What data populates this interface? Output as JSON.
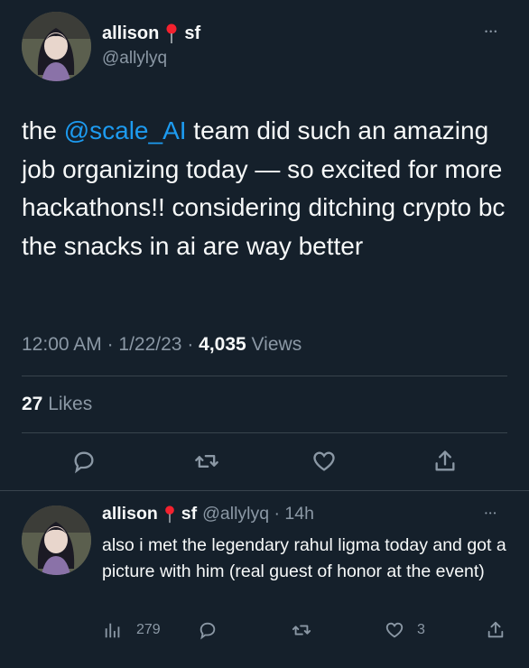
{
  "tweet": {
    "author_name": "allison",
    "author_location": "sf",
    "handle": "@allylyq",
    "text_before": "the ",
    "mention": "@scale_AI",
    "text_after": " team did such an amazing job organizing today — so excited for more hackathons!! considering ditching crypto bc the snacks in ai are way better",
    "time": "12:00 AM",
    "dot1": " · ",
    "date": "1/22/23",
    "dot2": " · ",
    "views_count": "4,035",
    "views_label": " Views",
    "likes_count": "27",
    "likes_label": " Likes",
    "more": "•••"
  },
  "reply": {
    "author_name": "allison",
    "author_location": "sf",
    "handle_time": "@allylyq · 14h",
    "text": "also i met the legendary rahul ligma today and got a picture with him (real guest of honor at the event)",
    "views": "279",
    "likes": "3",
    "more": "•••"
  },
  "icons": {
    "reply": "reply-icon",
    "retweet": "retweet-icon",
    "like": "heart-icon",
    "share": "share-icon",
    "views": "analytics-icon",
    "location": "pin-icon"
  },
  "colors": {
    "background": "#15202b",
    "text": "#f7f9f9",
    "muted": "#8b98a5",
    "link": "#1d9bf0",
    "divider": "#38444d",
    "pin": "#f4212e"
  }
}
